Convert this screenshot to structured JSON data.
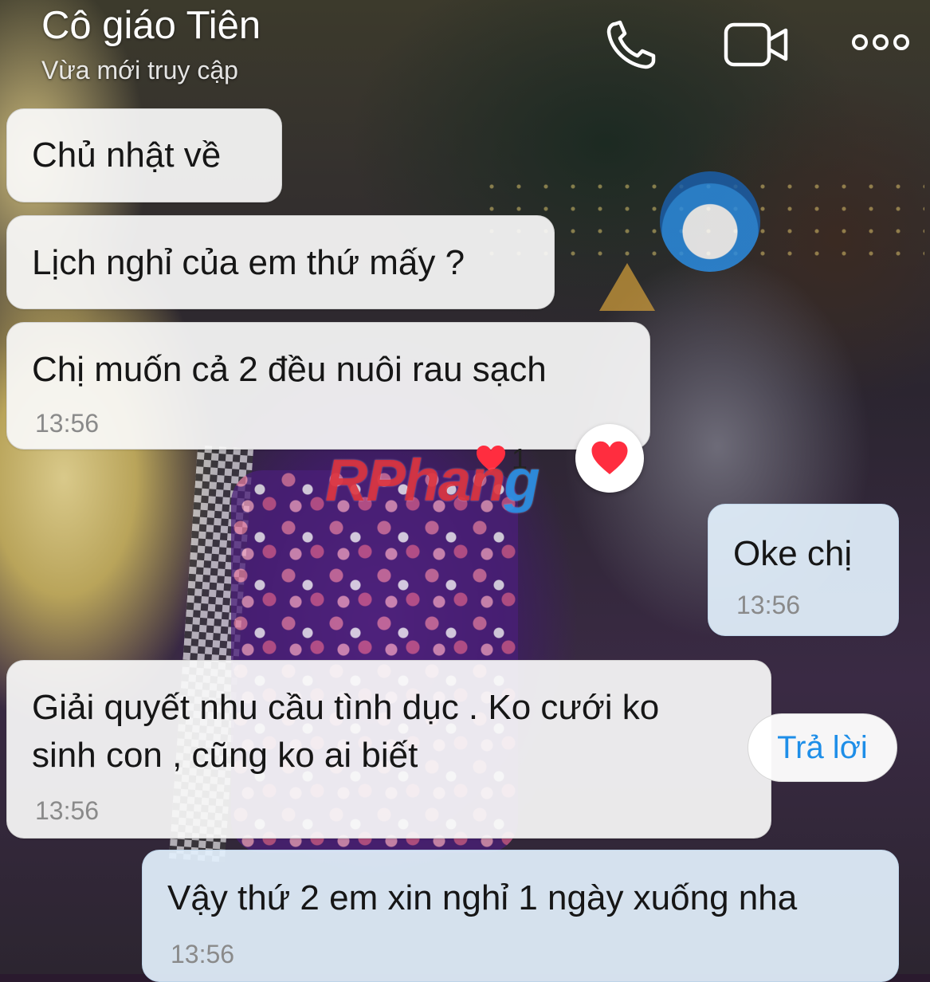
{
  "header": {
    "contact_name": "Cô giáo Tiên",
    "status": "Vừa mới truy cập",
    "icons": [
      "phone-icon",
      "video-call-icon",
      "more-options-icon"
    ]
  },
  "messages": [
    {
      "side": "incoming",
      "text": "Chủ nhật về",
      "time": ""
    },
    {
      "side": "incoming",
      "text": "Lịch nghỉ của em thứ mấy ?",
      "time": ""
    },
    {
      "side": "incoming",
      "text": "Chị muốn cả 2 đều nuôi rau sạch",
      "time": "13:56"
    },
    {
      "side": "outgoing",
      "text": "Oke chị",
      "time": "13:56"
    },
    {
      "side": "incoming",
      "text_lines": [
        "Giải quyết nhu cầu tình dục . Ko cưới ko",
        "sinh con , cũng ko ai biết"
      ],
      "time": "13:56"
    },
    {
      "side": "outgoing",
      "text": "Vậy thứ 2 em xin nghỉ 1 ngày xuống nha",
      "time": "13:56"
    }
  ],
  "reaction": {
    "icon": "heart-icon",
    "count": "1"
  },
  "reply_button_label": "Trả lời",
  "watermark": {
    "part1": "Phan",
    "part2": "g",
    "prefix": "R"
  },
  "colors": {
    "accent": "#1e8ee8",
    "heart": "#ff2d3f",
    "outgoing_bubble": "#e2f0fc",
    "incoming_bubble": "#fafafa"
  }
}
